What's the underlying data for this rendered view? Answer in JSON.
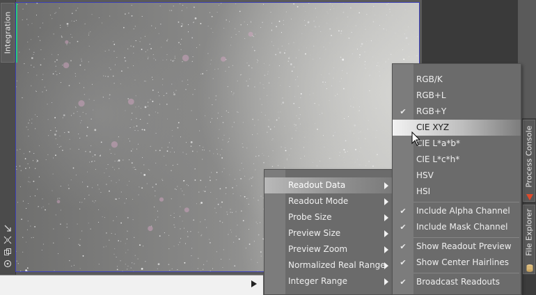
{
  "left_panel": {
    "tab_label": "Integration",
    "tool_icons": [
      "arrow-down-right-icon",
      "crosshair-icon",
      "copy-icon",
      "target-icon"
    ]
  },
  "right_panel": {
    "tabs": [
      {
        "label": "Process Console",
        "icon": "process-console-icon"
      },
      {
        "label": "File Explorer",
        "icon": "database-icon"
      }
    ]
  },
  "bottom_bar": {
    "play_icon": "play-icon"
  },
  "context_menu": {
    "items": [
      {
        "label": "Readout Data",
        "submenu": true
      },
      {
        "label": "Readout Mode",
        "submenu": true
      },
      {
        "label": "Probe Size",
        "submenu": true
      },
      {
        "label": "Preview Size",
        "submenu": true
      },
      {
        "label": "Preview Zoom",
        "submenu": true
      },
      {
        "label": "Normalized Real Range",
        "submenu": true
      },
      {
        "label": "Integer Range",
        "submenu": true
      }
    ]
  },
  "submenu": {
    "items": [
      {
        "label": "RGB/K",
        "checked": false
      },
      {
        "label": "RGB+L",
        "checked": false
      },
      {
        "label": "RGB+Y",
        "checked": true
      },
      {
        "label": "CIE XYZ",
        "checked": false
      },
      {
        "label": "CIE L*a*b*",
        "checked": false
      },
      {
        "label": "CIE L*c*h*",
        "checked": false
      },
      {
        "label": "HSV",
        "checked": false
      },
      {
        "label": "HSI",
        "checked": false
      },
      {
        "label": "Include Alpha Channel",
        "checked": true
      },
      {
        "label": "Include Mask Channel",
        "checked": true
      },
      {
        "label": "Show Readout Preview",
        "checked": true
      },
      {
        "label": "Show Center Hairlines",
        "checked": true
      },
      {
        "label": "Broadcast Readouts",
        "checked": true
      }
    ]
  },
  "colors": {
    "view_border": "#3b3fb8",
    "active_edge": "#29c97a",
    "menu_bg": "#6b6b6b"
  }
}
